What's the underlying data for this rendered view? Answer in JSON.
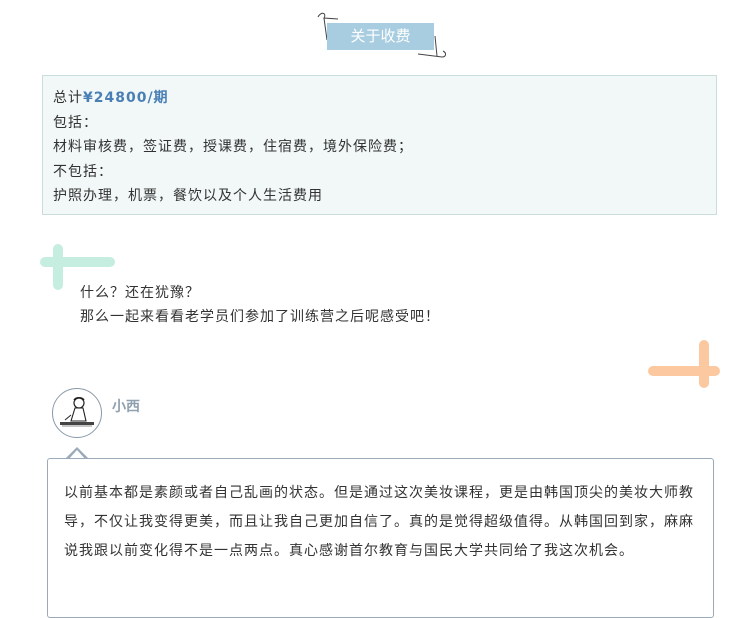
{
  "section": {
    "title": "关于收费"
  },
  "fees": {
    "total_label": "总计",
    "total_price": "¥24800/期",
    "includes_label": "包括：",
    "includes_items": "材料审核费，签证费，授课费，住宿费，境外保险费；",
    "excludes_label": "不包括：",
    "excludes_items": "护照办理，机票，餐饮以及个人生活费用"
  },
  "prompt": {
    "line1": "什么？还在犹豫？",
    "line2": "那么一起来看看老学员们参加了训练营之后呢感受吧！"
  },
  "testimonial": {
    "username": "小西",
    "text": "以前基本都是素颜或者自己乱画的状态。但是通过这次美妆课程，更是由韩国顶尖的美妆大师教导，不仅让我变得更美，而且让我自己更加自信了。真的是觉得超级值得。从韩国回到家，麻麻说我跟以前变化得不是一点两点。真心感谢首尔教育与国民大学共同给了我这次机会。"
  },
  "colors": {
    "title_bg": "#a8cde0",
    "fee_box_bg": "#f1f8f7",
    "price_color": "#4a7fb5",
    "mint_cross": "#c5ede0",
    "peach_cross": "#fcc8a0",
    "bubble_border": "#9aaab8"
  },
  "icons": {
    "avatar": "person-sketch-avatar",
    "title_decoration": "ribbon-line-decoration",
    "left_decoration": "mint-cross-decoration",
    "right_decoration": "peach-cross-decoration"
  }
}
